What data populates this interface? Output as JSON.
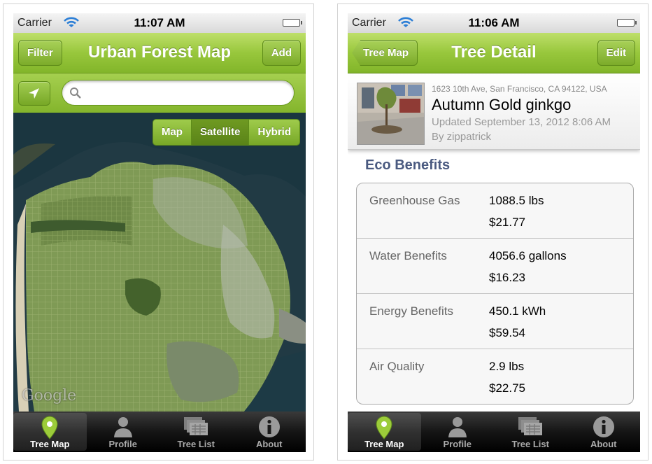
{
  "screens": {
    "map": {
      "status": {
        "carrier": "Carrier",
        "time": "11:07 AM"
      },
      "nav": {
        "title": "Urban Forest Map",
        "left_button": "Filter",
        "right_button": "Add"
      },
      "search": {
        "placeholder": "",
        "value": ""
      },
      "map_type": {
        "options": [
          "Map",
          "Satellite",
          "Hybrid"
        ],
        "selected": "Satellite"
      },
      "map_attribution": "Google"
    },
    "detail": {
      "status": {
        "carrier": "Carrier",
        "time": "11:06 AM"
      },
      "nav": {
        "title": "Tree Detail",
        "back_button": "Tree Map",
        "right_button": "Edit"
      },
      "tree": {
        "address": "1623 10th Ave, San Francisco, CA 94122, USA",
        "name": "Autumn Gold ginkgo",
        "updated": "Updated September 13, 2012 8:06 AM",
        "by": "By zippatrick"
      },
      "eco": {
        "title": "Eco Benefits",
        "rows": [
          {
            "label": "Greenhouse Gas",
            "amount": "1088.5 lbs",
            "money": "$21.77"
          },
          {
            "label": "Water Benefits",
            "amount": "4056.6 gallons",
            "money": "$16.23"
          },
          {
            "label": "Energy Benefits",
            "amount": "450.1 kWh",
            "money": "$59.54"
          },
          {
            "label": "Air Quality",
            "amount": "2.9 lbs",
            "money": "$22.75"
          }
        ]
      }
    }
  },
  "tabbar": {
    "items": [
      {
        "label": "Tree Map",
        "icon": "map-pin-icon"
      },
      {
        "label": "Profile",
        "icon": "profile-icon"
      },
      {
        "label": "Tree List",
        "icon": "tree-list-icon"
      },
      {
        "label": "About",
        "icon": "info-icon"
      }
    ],
    "active": "Tree Map"
  },
  "colors": {
    "nav_green": "#98c73c",
    "eco_title": "#4a5a80",
    "tab_active_pin": "#9ccc3a"
  }
}
